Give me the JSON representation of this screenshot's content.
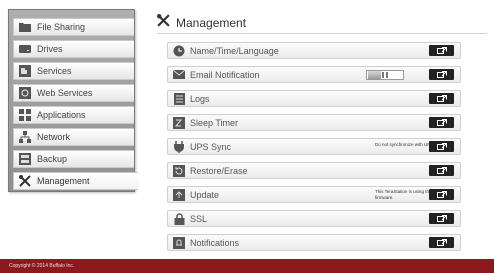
{
  "sidebar": {
    "items": [
      {
        "label": "File Sharing",
        "icon": "folder-icon"
      },
      {
        "label": "Drives",
        "icon": "drive-icon"
      },
      {
        "label": "Services",
        "icon": "puzzle-icon"
      },
      {
        "label": "Web Services",
        "icon": "web-services-icon"
      },
      {
        "label": "Applications",
        "icon": "applications-icon"
      },
      {
        "label": "Network",
        "icon": "network-icon"
      },
      {
        "label": "Backup",
        "icon": "backup-icon"
      },
      {
        "label": "Management",
        "icon": "management-tools-icon",
        "active": true
      }
    ]
  },
  "header": {
    "title": "Management",
    "icon": "management-tools-icon"
  },
  "rows": [
    {
      "label": "Name/Time/Language",
      "icon": "clock-icon"
    },
    {
      "label": "Email Notification",
      "icon": "envelope-icon",
      "toggle": "off"
    },
    {
      "label": "Logs",
      "icon": "logs-icon"
    },
    {
      "label": "Sleep Timer",
      "icon": "sleep-timer-icon"
    },
    {
      "label": "UPS Sync",
      "icon": "plug-icon",
      "note": "Do not synchronize with UPS"
    },
    {
      "label": "Restore/Erase",
      "icon": "restore-icon"
    },
    {
      "label": "Update",
      "icon": "update-icon",
      "note": "This TeraStation is using the latest firmware."
    },
    {
      "label": "SSL",
      "icon": "lock-icon"
    },
    {
      "label": "Notifications",
      "icon": "notifications-icon"
    }
  ],
  "footer": {
    "copyright": "Copyright © 2014 Buffalo Inc."
  },
  "colors": {
    "footer_bg": "#8b1a1f",
    "sidebar_bg": "#9e9e9e",
    "button_bg": "#222222"
  }
}
